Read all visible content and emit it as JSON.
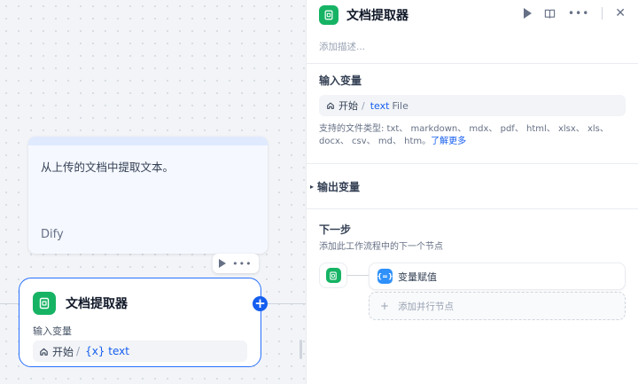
{
  "canvas": {
    "note": {
      "text": "从上传的文档中提取文本。",
      "author": "Dify"
    },
    "node": {
      "title": "文档提取器",
      "input_label": "输入变量",
      "var_start": "开始",
      "var_sep": "/",
      "var_name": "{x} text"
    },
    "toolbar": {
      "more": "•••"
    },
    "add_button": "+"
  },
  "panel": {
    "title": "文档提取器",
    "actions": {
      "more": "•••",
      "close": "✕"
    },
    "description_placeholder": "添加描述...",
    "input_section": {
      "title": "输入变量",
      "var_start": "开始",
      "var_sep": "/",
      "var_name": "text",
      "var_type": "File",
      "support_text": "支持的文件类型: txt、 markdown、 mdx、 pdf、 html、 xlsx、 xls、 docx、 csv、 md、 htm。",
      "learn_more": "了解更多"
    },
    "output_section": {
      "title": "输出变量"
    },
    "next_step": {
      "title": "下一步",
      "description": "添加此工作流程中的下一个节点",
      "next_node_icon": "{=}",
      "next_node_label": "变量赋值",
      "add_parallel_plus": "+",
      "add_parallel_label": "添加并行节点"
    }
  },
  "colors": {
    "accent": "#155eef",
    "doc_icon": "#16b364",
    "assign_icon": "#2e90fa"
  }
}
